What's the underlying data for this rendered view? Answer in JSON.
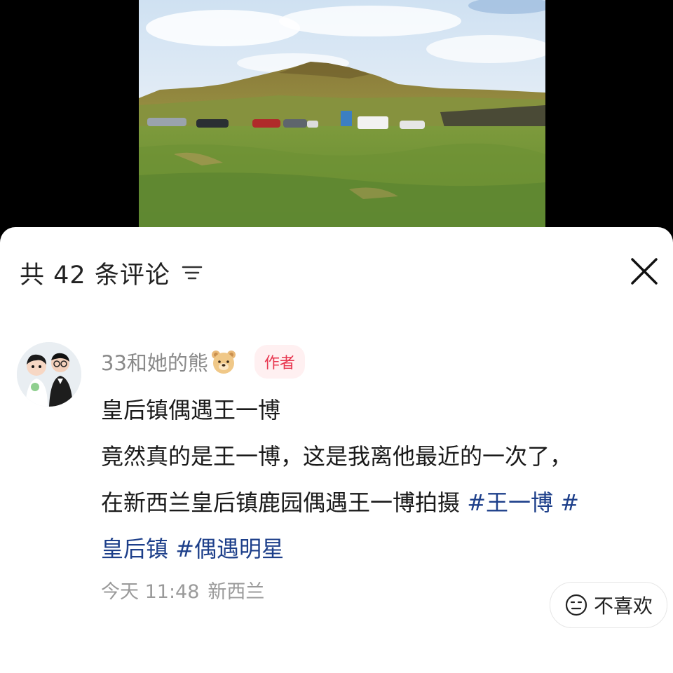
{
  "photo": {
    "description_icon": "landscape-photo"
  },
  "comments_panel": {
    "title_prefix": "共",
    "title_count": "42",
    "title_suffix": "条评论",
    "sort_icon": "sort-icon",
    "close_icon": "close-icon"
  },
  "comment": {
    "author": "33和她的熊",
    "author_emoji": "bear-face-icon",
    "badge": "作者",
    "lines": [
      "皇后镇偶遇王一博",
      "竟然真的是王一博，这是我离他最近的一次了，",
      "在新西兰皇后镇鹿园偶遇王一博拍摄 "
    ],
    "hashtags": [
      "#王一博",
      "#",
      "皇后镇",
      "#偶遇明星"
    ],
    "time": "今天 11:48",
    "location": "新西兰",
    "dislike_label": "不喜欢",
    "colors": {
      "hashtag": "#1d3f8a",
      "badge_text": "#e8364f",
      "badge_bg": "#fff0f1"
    }
  }
}
